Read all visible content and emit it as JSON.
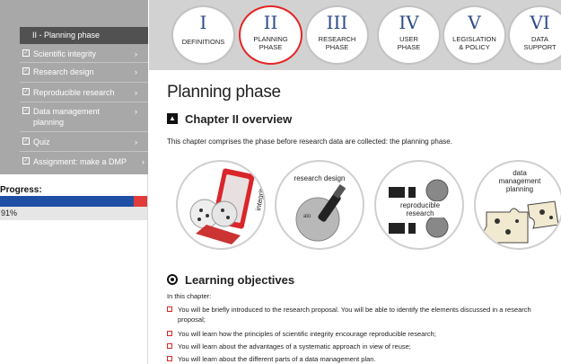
{
  "sidebar": {
    "title": "II - Planning phase",
    "items": [
      {
        "label": "Scientific integrity",
        "arrow": "›"
      },
      {
        "label": "Research design",
        "arrow": "›"
      },
      {
        "label": "Reproducible research",
        "arrow": "›"
      },
      {
        "label": "Data management planning",
        "arrow": "›"
      },
      {
        "label": "Quiz",
        "arrow": "›"
      },
      {
        "label": "Assignment: make a DMP",
        "arrow": "›"
      }
    ],
    "checkbox_glyph": "✓",
    "progress_label": "Progress:",
    "progress_value": "91%",
    "progress_fraction": 0.91
  },
  "chapters": [
    {
      "numeral": "I",
      "name": "DEFINITIONS",
      "active": false
    },
    {
      "numeral": "II",
      "name": "PLANNING\nPHASE",
      "active": true
    },
    {
      "numeral": "III",
      "name": "RESEARCH\nPHASE",
      "active": false
    },
    {
      "numeral": "IV",
      "name": "USER\nPHASE",
      "active": false
    },
    {
      "numeral": "V",
      "name": "LEGISLATION\n& POLICY",
      "active": false
    },
    {
      "numeral": "VI",
      "name": "DATA\nSUPPORT",
      "active": false
    }
  ],
  "main": {
    "title": "Planning phase",
    "overview_icon": "▲",
    "overview_title": "Chapter II overview",
    "overview_text": "This chapter comprises the phase before research data are collected: the planning phase.",
    "circles": {
      "integrity": "integrity",
      "research_design": "research design",
      "reproducible": "reproducible\nresearch",
      "dmp": "data\nmanagement\nplanning"
    },
    "objectives_title": "Learning objectives",
    "objectives_intro": "In this chapter:",
    "objectives": [
      "You will be briefly introduced to the research proposal. You will be able to identify the elements discussed in a research proposal;",
      "You will learn how the principles of scientific integrity encourage reproducible research;",
      "You will learn about the advantages of a systematic approach in view of reuse;",
      "You will learn about the different parts of a data management plan."
    ]
  },
  "colors": {
    "accent_red": "#e42626",
    "numeral_blue": "#2d4b86",
    "progress_blue": "#1f4fa5",
    "sidebar_gray": "#a8a8a8"
  }
}
